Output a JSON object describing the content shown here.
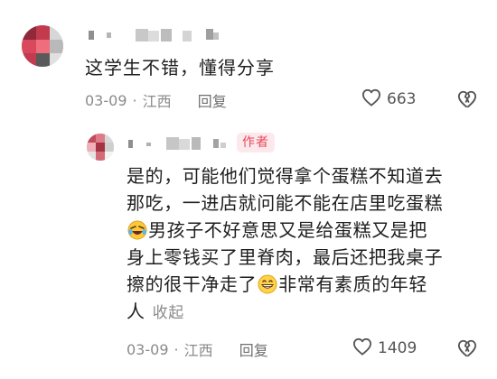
{
  "comments": [
    {
      "text": "这学生不错，懂得分享",
      "date": "03-09",
      "separator": "·",
      "location": "江西",
      "reply_label": "回复",
      "like_count": "663",
      "like_icon": "heart-outline-icon",
      "dislike_icon": "broken-heart-icon"
    },
    {
      "author_badge": "作者",
      "text_lines": [
        "是的，可能他们觉得拿个蛋糕不知道去",
        "那吃，一进店就问能不能在店里吃蛋糕",
        "男孩子不好意思又是给蛋糕又是把",
        "身上零钱买了里脊肉，最后还把我桌子",
        "擦的很干净走了",
        "非常有素质的年轻",
        "人"
      ],
      "emoji_1": "rolling-laughing-emoji",
      "emoji_2": "grinning-emoji",
      "collapse_label": "收起",
      "date": "03-09",
      "separator": "·",
      "location": "江西",
      "reply_label": "回复",
      "like_count": "1409",
      "like_icon": "heart-outline-icon",
      "dislike_icon": "broken-heart-icon"
    }
  ],
  "colors": {
    "badge_bg": "#fde9ec",
    "badge_text": "#e8475a",
    "meta_text": "#8a8a8a",
    "body_text": "#1e1e1e"
  }
}
